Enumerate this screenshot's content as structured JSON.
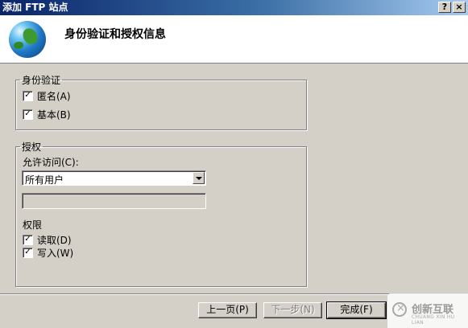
{
  "window": {
    "title": "添加 FTP 站点",
    "help_label": "?",
    "close_label": "×"
  },
  "header": {
    "title": "身份验证和授权信息"
  },
  "authentication": {
    "legend": "身份验证",
    "anonymous": {
      "label": "匿名(A)",
      "checked": true
    },
    "basic": {
      "label": "基本(B)",
      "checked": true
    }
  },
  "authorization": {
    "legend": "授权",
    "allow_access_label": "允许访问(C):",
    "allow_access_value": "所有用户",
    "users_textbox_value": "",
    "permissions_label": "权限",
    "read": {
      "label": "读取(D)",
      "checked": true
    },
    "write": {
      "label": "写入(W)",
      "checked": true
    }
  },
  "footer": {
    "previous_label": "上一页(P)",
    "next_label": "下一步(N)",
    "finish_label": "完成(F)"
  },
  "watermark": {
    "text": "创新互联",
    "subtext": "CHUANG XIN HU LIAN"
  },
  "checkmark": "✓"
}
